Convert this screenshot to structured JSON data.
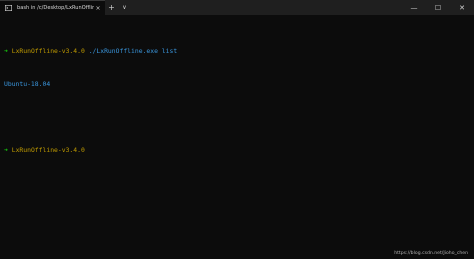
{
  "tab": {
    "title": "bash in /c/Desktop/LxRunOffline-v3.4.0",
    "icon": "terminal-icon",
    "close_glyph": "×",
    "new_tab_glyph": "+",
    "dropdown_glyph": "∨"
  },
  "window_controls": {
    "minimize_glyph": "—",
    "maximize_glyph": "☐",
    "close_glyph": "✕"
  },
  "terminal": {
    "line1": {
      "arrow": "➜",
      "dir": "LxRunOffline-v3.4.0",
      "command": "./LxRunOffline.exe list"
    },
    "line2": {
      "output": "Ubuntu-18.04"
    },
    "line3": {
      "arrow": "➜",
      "dir": "LxRunOffline-v3.4.0"
    }
  },
  "watermark": "https://blog.csdn.net/Jioho_chen",
  "colors": {
    "background": "#0c0c0c",
    "titlebar": "#1f1f1f",
    "prompt_arrow": "#16c60c",
    "prompt_dir": "#c19c00",
    "command": "#3a96dd"
  }
}
